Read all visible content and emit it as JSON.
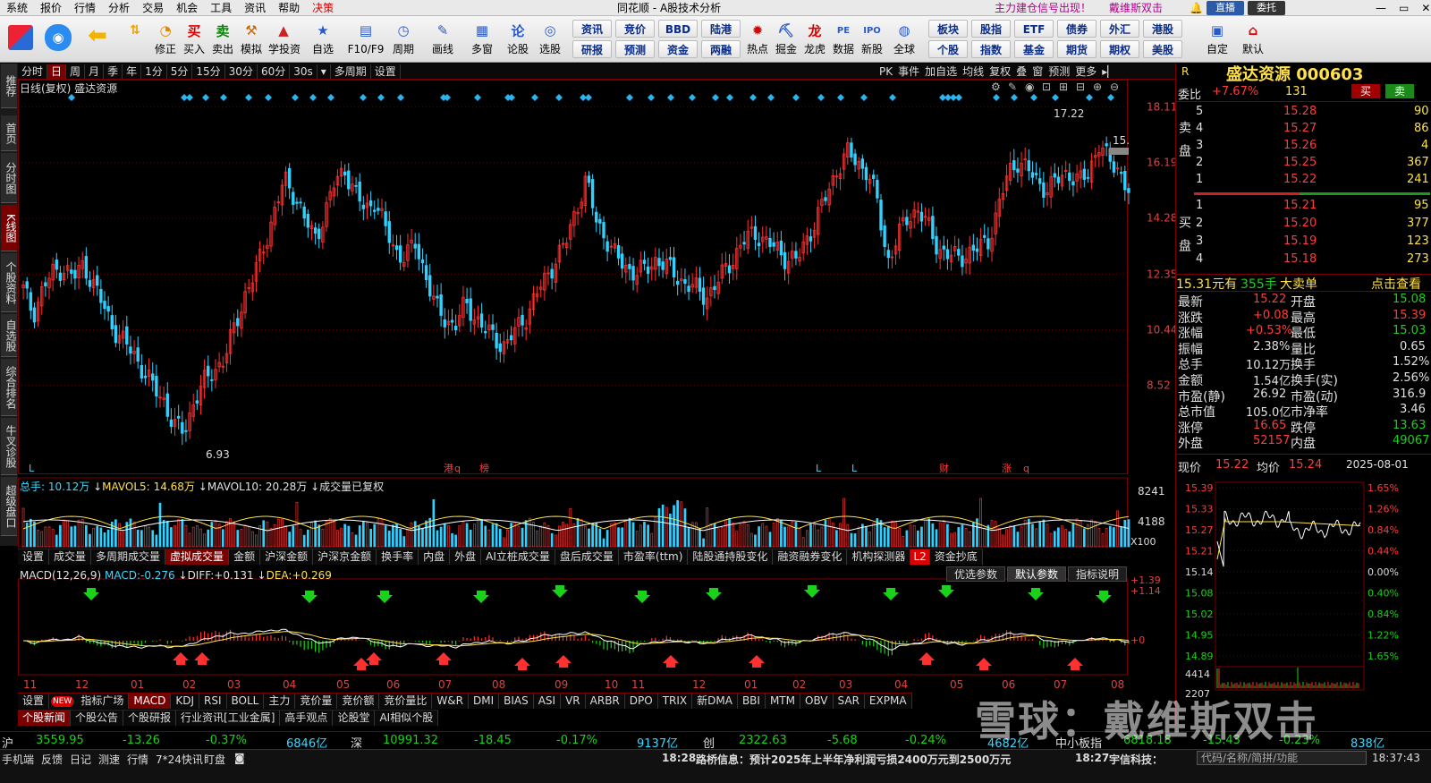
{
  "menubar": {
    "items": [
      "系统",
      "报价",
      "行情",
      "分析",
      "交易",
      "机会",
      "工具",
      "资讯",
      "帮助"
    ],
    "active": "决策",
    "center": "同花顺 - A股技术分析",
    "signal": "主力建仓信号出现！",
    "user": "戴维斯双击",
    "btn1": "直播",
    "btn2": "委托",
    "colors": {
      "accent": "#d00000",
      "signal": "#b0008a"
    }
  },
  "toolbar": {
    "buttons": [
      "修正",
      "买入",
      "卖出",
      "模拟",
      "学投资",
      "自选",
      "F10/F9",
      "周期",
      "画线",
      "多窗",
      "论股",
      "选股",
      "热点",
      "掘金",
      "龙虎",
      "数据",
      "新股",
      "全球",
      "自定",
      "默认"
    ],
    "grid": [
      [
        "资讯",
        "竞价",
        "BBD",
        "陆港"
      ],
      [
        "研报",
        "预测",
        "资金",
        "两融"
      ],
      [
        "板块",
        "股指",
        "ETF",
        "债券",
        "外汇",
        "港股"
      ],
      [
        "个股",
        "指数",
        "基金",
        "期货",
        "期权",
        "美股"
      ]
    ]
  },
  "lefttabs": [
    "推荐",
    "首页",
    "分时图",
    "K线图",
    "个股资料",
    "自选股",
    "综合排名",
    "牛叉诊股",
    "超级盘口"
  ],
  "periodbar": {
    "items": [
      "分时",
      "日",
      "周",
      "月",
      "季",
      "年",
      "1分",
      "5分",
      "15分",
      "30分",
      "60分",
      "30s"
    ],
    "active": "日",
    "extra": [
      "多周期",
      "设置"
    ],
    "right": [
      "PK",
      "事件",
      "加自选",
      "均线",
      "复权",
      "叠",
      "窗",
      "预测",
      "更多"
    ]
  },
  "chart": {
    "title": "日线(复权) 盛达资源",
    "price_ticks": [
      "18.11",
      "16.19",
      "14.28",
      "12.35",
      "10.44",
      "8.52"
    ],
    "max_label": "17.22",
    "min_label": "6.93",
    "last_label": "15.",
    "vol_info": {
      "total_label": "总手:",
      "total": "10.12万",
      "ma5_label": "MAVOL5:",
      "ma5": "14.68万",
      "ma10_label": "MAVOL10:",
      "ma10": "20.28万",
      "note": "成交量已复权"
    },
    "vol_ticks": [
      "8241",
      "4188",
      "X100"
    ],
    "vol_tabs": [
      "设置",
      "成交量",
      "多周期成交量",
      "虚拟成交量",
      "金额",
      "沪深金额",
      "沪深京金额",
      "换手率",
      "内盘",
      "外盘",
      "AI立桩成交量",
      "盘后成交量",
      "市盈率(ttm)",
      "陆股通持股变化",
      "融资融券变化",
      "机构探测器",
      "资金抄底"
    ],
    "vol_tab_active": "虚拟成交量",
    "l2_badge": "L2",
    "macd_info": {
      "name": "MACD(12,26,9)",
      "macd_label": "MACD:",
      "macd": "-0.276",
      "diff_label": "DIFF:",
      "diff": "+0.131",
      "dea_label": "DEA:",
      "dea": "+0.269"
    },
    "macd_btns": [
      "优选参数",
      "默认参数",
      "指标说明"
    ],
    "macd_ticks": [
      "+1.39",
      "+1.14",
      "+0"
    ],
    "months": [
      "11",
      "12",
      "01",
      "02",
      "03",
      "04",
      "05",
      "06",
      "07",
      "08",
      "09",
      "10",
      "11",
      "12",
      "01",
      "02",
      "03",
      "04",
      "05",
      "06",
      "07",
      "08"
    ],
    "markers": [
      "L",
      "港",
      "q",
      "榜",
      "L",
      "L",
      "财",
      "涨",
      "q"
    ],
    "ind_tabs": [
      "设置",
      "NEW",
      "指标广场",
      "MACD",
      "KDJ",
      "RSI",
      "BOLL",
      "主力",
      "竞价量",
      "竞价额",
      "竞价量比",
      "W&R",
      "DMI",
      "BIAS",
      "ASI",
      "VR",
      "ARBR",
      "DPO",
      "TRIX",
      "新DMA",
      "BBI",
      "MTM",
      "OBV",
      "SAR",
      "EXPMA"
    ],
    "ind_active": "MACD",
    "news_tabs": [
      "个股新闻",
      "个股公告",
      "个股研报",
      "行业资讯[工业金属]",
      "高手观点",
      "论股堂",
      "AI相似个股"
    ],
    "news_active": "个股新闻"
  },
  "chart_data": {
    "type": "candlestick",
    "title": "日线(复权) 盛达资源",
    "y_axis_ticks": [
      18.11,
      16.19,
      14.28,
      12.35,
      10.44,
      8.52
    ],
    "x_axis_ticks": [
      "11",
      "12",
      "01",
      "02",
      "03",
      "04",
      "05",
      "06",
      "07",
      "08",
      "09",
      "10",
      "11",
      "12",
      "01",
      "02",
      "03",
      "04",
      "05",
      "06",
      "07",
      "08"
    ],
    "period_high": 17.22,
    "period_low": 6.93,
    "close_path": [
      11.8,
      11.0,
      11.9,
      12.4,
      12.6,
      12.2,
      12.7,
      12.0,
      11.2,
      10.5,
      10.0,
      9.6,
      9.0,
      8.4,
      8.0,
      7.1,
      6.93,
      8.0,
      8.6,
      9.1,
      9.4,
      10.5,
      11.6,
      12.3,
      13.4,
      14.5,
      15.6,
      15.1,
      14.2,
      13.6,
      14.4,
      15.5,
      16.0,
      15.1,
      14.6,
      14.9,
      13.9,
      13.2,
      12.9,
      13.4,
      12.4,
      11.2,
      10.8,
      10.6,
      11.3,
      10.9,
      10.4,
      10.1,
      9.9,
      10.4,
      10.9,
      11.6,
      12.2,
      12.9,
      13.4,
      14.6,
      15.6,
      14.2,
      13.6,
      12.9,
      12.6,
      12.4,
      12.5,
      12.9,
      12.6,
      12.3,
      12.0,
      11.8,
      11.6,
      12.0,
      12.6,
      13.1,
      13.6,
      13.8,
      13.4,
      13.2,
      12.9,
      12.8,
      13.6,
      14.3,
      15.1,
      16.0,
      16.5,
      16.2,
      15.9,
      14.8,
      12.8,
      13.6,
      14.3,
      14.6,
      14.0,
      13.3,
      13.0,
      12.9,
      13.1,
      13.2,
      13.5,
      14.6,
      15.8,
      16.3,
      15.9,
      15.5,
      15.3,
      15.6,
      15.9,
      15.5,
      15.8,
      16.9,
      16.2,
      16.0,
      15.22
    ]
  },
  "quote": {
    "badge": "R",
    "name": "盛达资源 000603",
    "wb_label": "委比",
    "wb": "+7.67%",
    "wb_num": "131",
    "buy": "买",
    "sell": "卖",
    "sell_label": "卖盘",
    "buy_label": "买盘",
    "asks": [
      [
        "5",
        "15.28",
        "90"
      ],
      [
        "4",
        "15.27",
        "86"
      ],
      [
        "3",
        "15.26",
        "4"
      ],
      [
        "2",
        "15.25",
        "367"
      ],
      [
        "1",
        "15.22",
        "241"
      ]
    ],
    "bids": [
      [
        "1",
        "15.21",
        "95"
      ],
      [
        "2",
        "15.20",
        "377"
      ],
      [
        "3",
        "15.19",
        "123"
      ],
      [
        "4",
        "15.18",
        "273"
      ]
    ],
    "big_price": "15.31元有",
    "big_vol": "355手",
    "big_label": "大卖单",
    "big_link": "点击查看",
    "stats": [
      [
        "最新",
        "15.22",
        "开盘",
        "15.08"
      ],
      [
        "涨跌",
        "+0.08",
        "最高",
        "15.39"
      ],
      [
        "涨幅",
        "+0.53%",
        "最低",
        "15.03"
      ],
      [
        "振幅",
        "2.38%",
        "量比",
        "0.65"
      ],
      [
        "总手",
        "10.12万",
        "换手",
        "1.52%"
      ],
      [
        "金额",
        "1.54亿",
        "换手(实)",
        "2.56%"
      ],
      [
        "市盈(静)",
        "26.92",
        "市盈(动)",
        "316.9"
      ],
      [
        "总市值",
        "105.0亿",
        "市净率",
        "3.46"
      ],
      [
        "涨停",
        "16.65",
        "跌停",
        "13.63"
      ],
      [
        "外盘",
        "52157",
        "内盘",
        "49067"
      ]
    ],
    "mini": {
      "now_label": "现价",
      "now": "15.22",
      "avg_label": "均价",
      "avg": "15.24",
      "date": "2025-08-01",
      "left_ticks": [
        "15.39",
        "15.33",
        "15.27",
        "15.21",
        "15.14",
        "15.08",
        "15.02",
        "14.95",
        "14.89"
      ],
      "right_ticks": [
        "1.65%",
        "1.26%",
        "0.84%",
        "0.44%",
        "0.00%",
        "0.40%",
        "0.84%",
        "1.22%",
        "1.65%"
      ],
      "vol_ticks": [
        "4414",
        "2207"
      ]
    }
  },
  "indexbar": [
    {
      "name": "沪",
      "value": "3559.95",
      "chg": "-13.26",
      "pct": "-0.37%",
      "amt": "6846亿"
    },
    {
      "name": "深",
      "value": "10991.32",
      "chg": "-18.45",
      "pct": "-0.17%",
      "amt": "9137亿"
    },
    {
      "name": "创",
      "value": "2322.63",
      "chg": "-5.68",
      "pct": "-0.24%",
      "amt": "4682亿"
    },
    {
      "name": "中小板指",
      "value": "6818.18",
      "chg": "-15.43",
      "pct": "-0.23%",
      "amt": "838亿"
    }
  ],
  "statusbar": {
    "items": [
      "手机端",
      "反馈",
      "日记",
      "测速",
      "行情",
      "7*24快讯",
      "盯盘"
    ],
    "news1_time": "18:28",
    "news1": "路桥信息：预计2025年上半年净利润亏损2400万元到2500万元",
    "news2_time": "18:27",
    "news2": "宇信科技：",
    "search": "代码/名称/简拼/功能",
    "clock": "18:37:43"
  },
  "watermark": "雪球：戴维斯双击"
}
